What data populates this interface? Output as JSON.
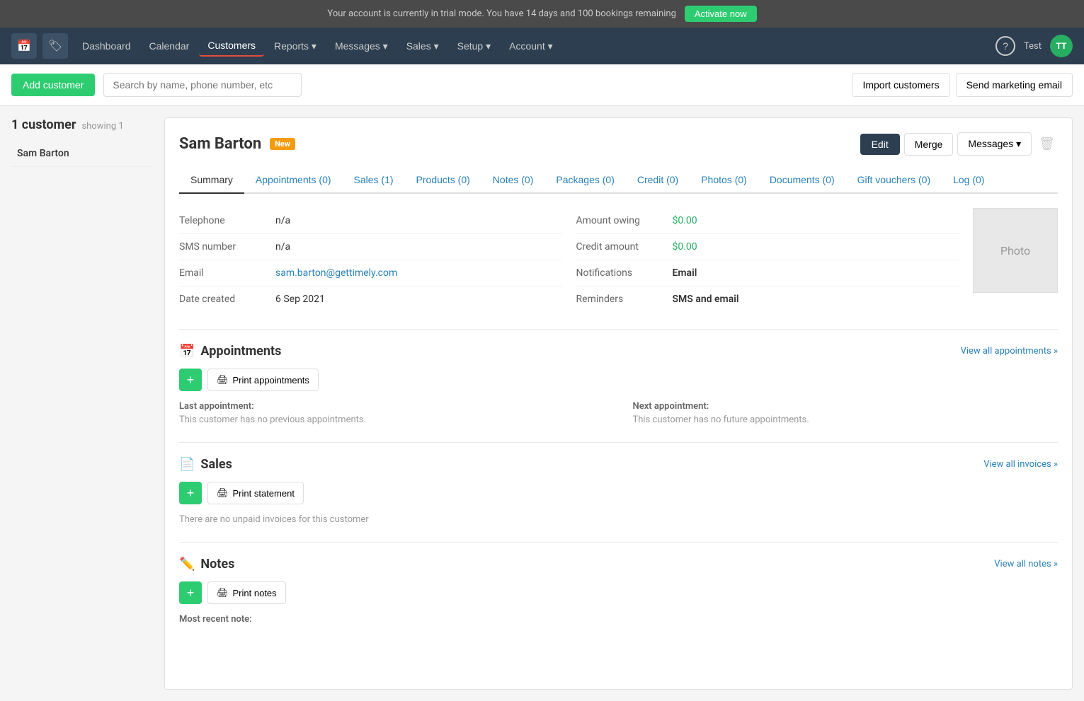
{
  "trial_banner": {
    "message": "Your account is currently in trial mode. You have 14 days and 100 bookings remaining",
    "activate_label": "Activate now"
  },
  "nav": {
    "icons": [
      "calendar",
      "tag"
    ],
    "links": [
      {
        "label": "Dashboard",
        "active": false
      },
      {
        "label": "Calendar",
        "active": false
      },
      {
        "label": "Customers",
        "active": true
      },
      {
        "label": "Reports",
        "active": false,
        "dropdown": true
      },
      {
        "label": "Messages",
        "active": false,
        "dropdown": true
      },
      {
        "label": "Sales",
        "active": false,
        "dropdown": true
      },
      {
        "label": "Setup",
        "active": false,
        "dropdown": true
      },
      {
        "label": "Account",
        "active": false,
        "dropdown": true
      }
    ],
    "user_name": "Test",
    "avatar": "TT"
  },
  "toolbar": {
    "add_customer_label": "Add customer",
    "search_placeholder": "Search by name, phone number, etc",
    "import_label": "Import customers",
    "send_marketing_label": "Send marketing email"
  },
  "sidebar": {
    "count_label": "1 customer",
    "showing_label": "showing 1",
    "customers": [
      {
        "name": "Sam Barton"
      }
    ]
  },
  "detail": {
    "customer_name": "Sam Barton",
    "badge": "New",
    "actions": {
      "edit": "Edit",
      "merge": "Merge",
      "messages": "Messages"
    },
    "tabs": [
      {
        "label": "Summary",
        "active": true
      },
      {
        "label": "Appointments (0)",
        "active": false
      },
      {
        "label": "Sales (1)",
        "active": false
      },
      {
        "label": "Products (0)",
        "active": false
      },
      {
        "label": "Notes (0)",
        "active": false
      },
      {
        "label": "Packages (0)",
        "active": false
      },
      {
        "label": "Credit (0)",
        "active": false
      },
      {
        "label": "Photos (0)",
        "active": false
      },
      {
        "label": "Documents (0)",
        "active": false
      },
      {
        "label": "Gift vouchers (0)",
        "active": false
      },
      {
        "label": "Log (0)",
        "active": false
      }
    ],
    "summary": {
      "left": [
        {
          "label": "Telephone",
          "value": "n/a",
          "type": "plain"
        },
        {
          "label": "SMS number",
          "value": "n/a",
          "type": "plain"
        },
        {
          "label": "Email",
          "value": "sam.barton@gettimely.com",
          "type": "link"
        },
        {
          "label": "Date created",
          "value": "6 Sep 2021",
          "type": "plain"
        }
      ],
      "right": [
        {
          "label": "Amount owing",
          "value": "$0.00",
          "type": "money"
        },
        {
          "label": "Credit amount",
          "value": "$0.00",
          "type": "money"
        },
        {
          "label": "Notifications",
          "value": "Email",
          "type": "bold"
        },
        {
          "label": "Reminders",
          "value": "SMS and email",
          "type": "bold"
        }
      ],
      "photo_label": "Photo"
    },
    "appointments": {
      "title": "Appointments",
      "view_all": "View all appointments »",
      "print_label": "Print appointments",
      "last_label": "Last appointment:",
      "last_value": "This customer has no previous appointments.",
      "next_label": "Next appointment:",
      "next_value": "This customer has no future appointments."
    },
    "sales": {
      "title": "Sales",
      "view_all": "View all invoices »",
      "print_label": "Print statement",
      "no_items": "There are no unpaid invoices for this customer"
    },
    "notes": {
      "title": "Notes",
      "view_all": "View all notes »",
      "print_label": "Print notes",
      "recent_label": "Most recent note:"
    }
  }
}
